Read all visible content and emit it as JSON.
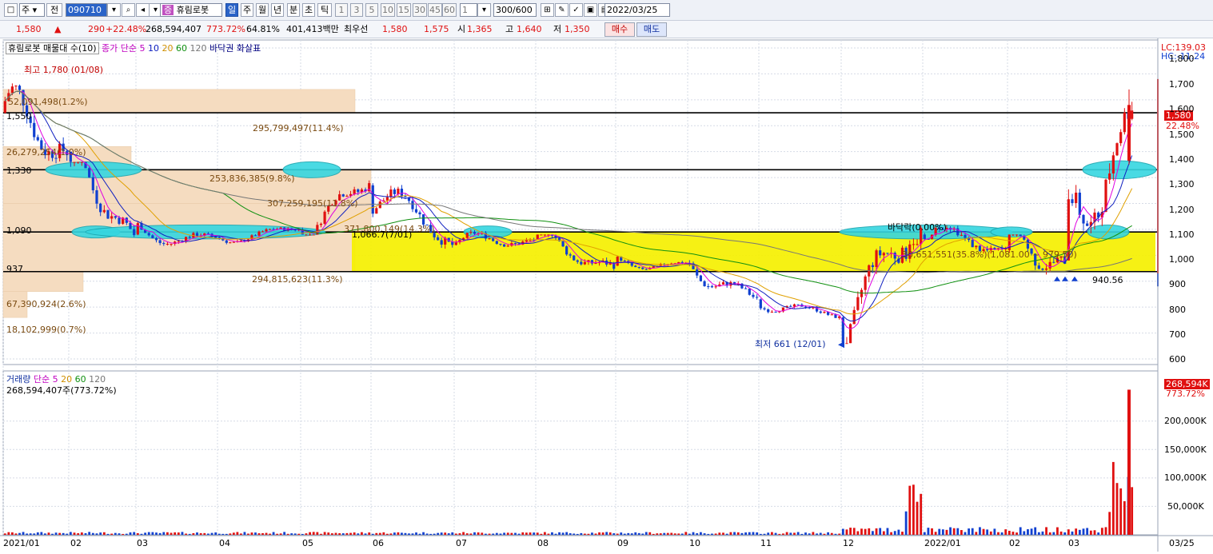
{
  "toolbar": {
    "period_select": "주",
    "prev_label": "전",
    "code_value": "090710",
    "stock_name": "휴림로봇",
    "period_tabs": [
      "일",
      "주",
      "월",
      "년",
      "분",
      "초",
      "틱"
    ],
    "active_tab": "일",
    "intervals": [
      "1",
      "3",
      "5",
      "10",
      "15",
      "30",
      "45",
      "60"
    ],
    "interval_value": "1",
    "count_value": "300",
    "count_max": "/600",
    "date_value": "2022/03/25"
  },
  "quote": {
    "price": "1,580",
    "change": "290",
    "change_pct": "+22.48%",
    "volume": "268,594,407",
    "volume_ratio": "773.72%",
    "turnover": "64.81%",
    "amount": "401,413백만",
    "priority_label": "최우선",
    "ask": "1,580",
    "bid": "1,575",
    "open_label": "시",
    "open": "1,365",
    "high_label": "고",
    "high": "1,640",
    "low_label": "저",
    "low": "1,350",
    "buy_label": "매수",
    "sell_label": "매도"
  },
  "legend": {
    "name": "휴림로봇 매물대 수(10)",
    "ma_label": "종가 단순 5",
    "ma_periods": [
      "10",
      "20",
      "60",
      "120"
    ],
    "ma_colors": [
      "#e000e0",
      "#1020c0",
      "#e0a000",
      "#109010",
      "#777777"
    ],
    "extra": "바닥권 화살표"
  },
  "right_info": {
    "lc": "LC:139.03",
    "hc": "HC:-11.24",
    "price_tag": "1,580",
    "pct_tag": "22.48%"
  },
  "annotations": {
    "high": "최고 1,780 (01/08)",
    "low": "최저 661 (12/01)",
    "bottom": "바닥락(0.00%)",
    "mid1": "1,066.7(7/01)",
    "range": "30,651,551(35.8%)(1,081.00 ~ 979.50)",
    "last_low": "940.56"
  },
  "levels": [
    {
      "label": "1,550",
      "value": 1550
    },
    {
      "label": "1,330",
      "value": 1330
    },
    {
      "label": "1,090",
      "value": 1090
    },
    {
      "label": "937",
      "value": 937
    }
  ],
  "volume_profile": [
    {
      "label": "52,091,498(1.2%)",
      "value": 52091498
    },
    {
      "label": "295,799,497(11.4%)",
      "value": 295799497
    },
    {
      "label": "26,279,254(1.0%)",
      "value": 26279254
    },
    {
      "label": "253,836,385(9.8%)",
      "value": 253836385
    },
    {
      "label": "307,259,195(11.8%)",
      "value": 307259195
    },
    {
      "label": "371,800,149(14.3%)",
      "value": 371800149
    },
    {
      "label": "294,815,623(11.3%)",
      "value": 294815623
    },
    {
      "label": "67,390,924(2.6%)",
      "value": 67390924
    },
    {
      "label": "18,102,999(0.7%)",
      "value": 18102999
    }
  ],
  "price_axis": [
    "1,800",
    "1,700",
    "1,600",
    "1,500",
    "1,400",
    "1,300",
    "1,200",
    "1,100",
    "1,000",
    "900",
    "800",
    "700",
    "600"
  ],
  "volume_legend": {
    "title": "거래량",
    "ma_label": "단순 5",
    "periods": [
      "20",
      "60",
      "120"
    ],
    "current": "268,594,407주(773.72%)"
  },
  "volume_axis": [
    "200,000K",
    "150,000K",
    "100,000K",
    "50,000K"
  ],
  "volume_tag": "268,594K",
  "volume_pct_tag": "773.72%",
  "date_axis": [
    "2021/01",
    "02",
    "03",
    "04",
    "05",
    "06",
    "07",
    "08",
    "09",
    "10",
    "11",
    "12",
    "2022/01",
    "02",
    "03",
    "03/25"
  ],
  "colors": {
    "up": "#e01010",
    "down": "#1040d0",
    "zone": "#f5f000",
    "highlight": "#36d6e0",
    "profile": "#f5dcc0"
  },
  "chart_data": {
    "type": "candlestick",
    "price_range": [
      600,
      1800
    ],
    "volume_range": [
      0,
      260000000
    ],
    "monthly": [
      {
        "x": "2021/01",
        "open": 1550,
        "high": 1780,
        "low": 1300,
        "close": 1400
      },
      {
        "x": "02",
        "open": 1400,
        "high": 1360,
        "low": 1000,
        "close": 1080
      },
      {
        "x": "03",
        "open": 1080,
        "high": 1150,
        "low": 990,
        "close": 1070
      },
      {
        "x": "04",
        "open": 1070,
        "high": 1130,
        "low": 1020,
        "close": 1100
      },
      {
        "x": "05",
        "open": 1100,
        "high": 1330,
        "low": 1080,
        "close": 1270
      },
      {
        "x": "06",
        "open": 1270,
        "high": 1300,
        "low": 1000,
        "close": 1040
      },
      {
        "x": "07",
        "open": 1040,
        "high": 1150,
        "low": 990,
        "close": 1060
      },
      {
        "x": "08",
        "open": 1060,
        "high": 1080,
        "low": 870,
        "close": 960
      },
      {
        "x": "09",
        "open": 960,
        "high": 1030,
        "low": 930,
        "close": 970
      },
      {
        "x": "10",
        "open": 970,
        "high": 990,
        "low": 800,
        "close": 830
      },
      {
        "x": "11",
        "open": 830,
        "high": 850,
        "low": 740,
        "close": 760
      },
      {
        "x": "12",
        "open": 760,
        "high": 1150,
        "low": 661,
        "close": 1080
      },
      {
        "x": "2022/01",
        "open": 1080,
        "high": 1220,
        "low": 1000,
        "close": 1020
      },
      {
        "x": "02",
        "open": 1020,
        "high": 1080,
        "low": 760,
        "close": 980
      },
      {
        "x": "03",
        "open": 980,
        "high": 1640,
        "low": 940,
        "close": 1580
      }
    ]
  }
}
